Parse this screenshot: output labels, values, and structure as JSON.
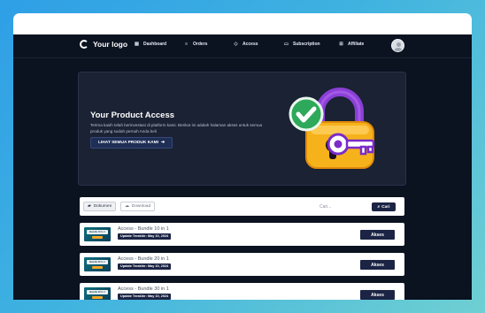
{
  "nav": {
    "logo": "Your logo",
    "items": [
      {
        "label": "Dashboard",
        "icon": "grid-icon"
      },
      {
        "label": "Orders",
        "icon": "list-icon"
      },
      {
        "label": "Access",
        "icon": "diamond-icon"
      },
      {
        "label": "Subscription",
        "icon": "card-icon"
      },
      {
        "label": "Affiliate",
        "icon": "share-icon"
      }
    ]
  },
  "hero": {
    "title": "Your Product Access",
    "description": "Terima kasih telah berinvestasi di platform kami. Berikut ini adalah halaman akses untuk semua produk yang sudah pernah Anda beli",
    "button": "LIHAT SEMUA PRODUK KAMI"
  },
  "filter": {
    "tabs": [
      {
        "label": "Dokumen",
        "icon": "folder-icon",
        "active": true
      },
      {
        "label": "Download",
        "icon": "cloud-download-icon",
        "active": false
      }
    ],
    "search_placeholder": "Cari...",
    "search_button": "Cari"
  },
  "products": [
    {
      "title": "Access - Bundle 10 in 1",
      "updated": "Update Terakhir: May 10, 2024",
      "thumb": "Bundle 10 in 1",
      "action": "Akses"
    },
    {
      "title": "Access - Bundle 20 in 1",
      "updated": "Update Terakhir: May 10, 2024",
      "thumb": "Bundle 20 in 1",
      "action": "Akses"
    },
    {
      "title": "Access - Bundle 30 in 1",
      "updated": "Update Terakhir: May 10, 2024",
      "thumb": "Bundle 30 in 1",
      "action": "Akses"
    }
  ],
  "colors": {
    "background_gradient": [
      "#2f9fe6",
      "#6fd0d2"
    ],
    "app_bg": "#0b1220",
    "card_bg": "#1a2233",
    "primary_button": "#1b2444",
    "lock_body": "#f6b21b",
    "lock_shackle": "#8a3fd6",
    "check_badge": "#2ea85a"
  }
}
